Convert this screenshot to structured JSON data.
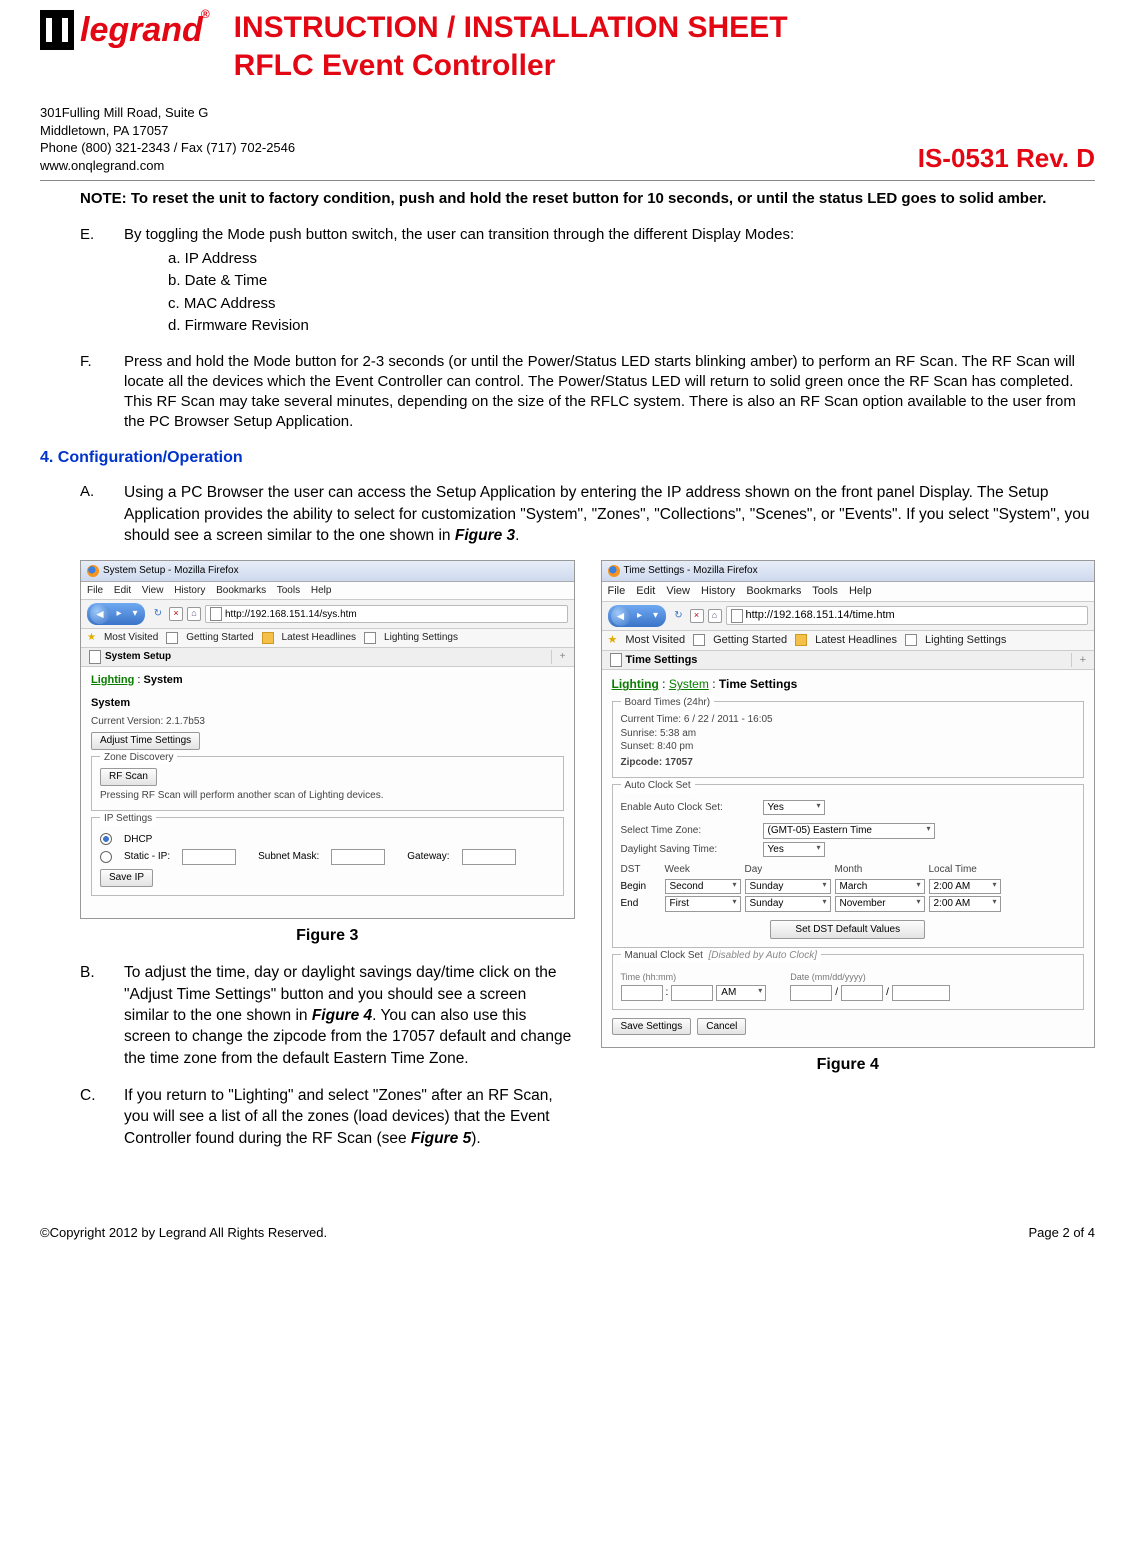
{
  "header": {
    "logo_text": "legrand",
    "logo_sup": "®",
    "title_line1": "INSTRUCTION / INSTALLATION SHEET",
    "title_line2": "RFLC Event Controller"
  },
  "meta": {
    "addr1": "301Fulling Mill Road, Suite G",
    "addr2": "Middletown, PA 17057",
    "addr3": "Phone (800) 321-2343 / Fax (717) 702-2546",
    "addr4": "www.onqlegrand.com",
    "rev": "IS-0531 Rev. D"
  },
  "body": {
    "note": "NOTE: To reset the unit to factory condition, push and hold the reset button for 10 seconds, or until the status LED goes to solid amber.",
    "E_letter": "E.",
    "E_text": "By toggling the Mode push button switch, the user can transition through the different Display Modes:",
    "E_sub": {
      "a": "a.    IP Address",
      "b": "b.    Date & Time",
      "c": "c.    MAC Address",
      "d": "d.    Firmware Revision"
    },
    "F_letter": "F.",
    "F_text": "Press and hold the Mode button for 2-3 seconds (or until the Power/Status LED starts blinking amber) to perform an RF Scan. The RF Scan will locate all the devices which the Event Controller can control. The Power/Status LED will return to solid green once the RF Scan has completed. This RF Scan may take several minutes, depending on the size of the RFLC system. There is also an RF Scan option available to the user from the PC Browser Setup Application.",
    "section4": "4.   Configuration/Operation",
    "A_letter": "A.",
    "A_text_1": "Using a PC Browser the user can access the Setup Application by entering the IP address shown on the front panel Display. The Setup Application provides the ability to select for customization \"System\", \"Zones\", \"Collections\", \"Scenes\", or \"Events\". If you select \"System\", you should see a screen similar to the one shown in ",
    "A_fig_ref": "Figure 3",
    "A_text_2": ".",
    "B_letter": "B.",
    "B_text_1": "To adjust the time, day or daylight savings day/time click on the \"Adjust Time Settings\" button and you should see a screen similar to the one shown in ",
    "B_fig_ref": "Figure 4",
    "B_text_2": ". You can also use this screen to change the zipcode from the 17057 default and change the time zone from the default Eastern Time Zone.",
    "C_letter": "C.",
    "C_text_1": "If you return to \"Lighting\" and select \"Zones\" after an RF Scan, you will see a list of all the zones (load devices) that the Event Controller found during the RF Scan (see ",
    "C_fig_ref": "Figure 5",
    "C_text_2": ")."
  },
  "fig3": {
    "title": "System Setup - Mozilla Firefox",
    "menu": {
      "file": "File",
      "edit": "Edit",
      "view": "View",
      "history": "History",
      "bookmarks": "Bookmarks",
      "tools": "Tools",
      "help": "Help"
    },
    "url": "http://192.168.151.14/sys.htm",
    "bm_mv": "Most Visited",
    "bm_gs": "Getting Started",
    "bm_lh": "Latest Headlines",
    "bm_ls": "Lighting Settings",
    "tab": "System Setup",
    "crumb_lighting": "Lighting",
    "crumb_sep": " : ",
    "crumb_system": "System",
    "section_system": "System",
    "version_label": "Current Version: 2.1.7b53",
    "adjust_btn": "Adjust Time Settings",
    "legend_zone": "Zone Discovery",
    "rf_scan_btn": "RF Scan",
    "rf_scan_text": "Pressing RF Scan will perform another scan of Lighting devices.",
    "legend_ip": "IP Settings",
    "dhcp": "DHCP",
    "static": "Static - IP:",
    "subnet_lbl": "Subnet Mask:",
    "gateway_lbl": "Gateway:",
    "save_ip": "Save IP",
    "caption": "Figure 3"
  },
  "fig4": {
    "title": "Time Settings - Mozilla Firefox",
    "menu": {
      "file": "File",
      "edit": "Edit",
      "view": "View",
      "history": "History",
      "bookmarks": "Bookmarks",
      "tools": "Tools",
      "help": "Help"
    },
    "url": "http://192.168.151.14/time.htm",
    "bm_mv": "Most Visited",
    "bm_gs": "Getting Started",
    "bm_lh": "Latest Headlines",
    "bm_ls": "Lighting Settings",
    "tab": "Time Settings",
    "crumb_lighting": "Lighting",
    "crumb_sep1": " : ",
    "crumb_system": "System",
    "crumb_sep2": " : ",
    "crumb_time": "Time Settings",
    "legend_board": "Board Times (24hr)",
    "current_time": "Current Time: 6 / 22 / 2011 - 16:05",
    "sunrise": "Sunrise: 5:38 am",
    "sunset": "Sunset: 8:40 pm",
    "zip_label": "Zipcode:  17057",
    "legend_auto": "Auto Clock Set",
    "enable_lbl": "Enable Auto Clock Set:",
    "enable_val": "Yes",
    "tz_lbl": "Select Time Zone:",
    "tz_val": "(GMT-05) Eastern Time",
    "dst_lbl": "Daylight Saving Time:",
    "dst_val": "Yes",
    "hdr_dst": "DST",
    "hdr_week": "Week",
    "hdr_day": "Day",
    "hdr_month": "Month",
    "hdr_local": "Local Time",
    "row_begin": "Begin",
    "begin_week": "Second",
    "begin_day": "Sunday",
    "begin_month": "March",
    "begin_time": "2:00 AM",
    "row_end": "End",
    "end_week": "First",
    "end_day": "Sunday",
    "end_month": "November",
    "end_time": "2:00 AM",
    "set_dst_btn": "Set DST Default Values",
    "legend_manual": "Manual Clock Set",
    "legend_manual_note": "[Disabled by Auto Clock]",
    "time_lbl": "Time (hh:mm)",
    "date_lbl": "Date (mm/dd/yyyy)",
    "ampm": "AM",
    "slash": "/",
    "colon": ":",
    "save_btn": "Save Settings",
    "cancel_btn": "Cancel",
    "caption": "Figure 4"
  },
  "footer": {
    "copyright": "©Copyright 2012 by Legrand All Rights Reserved.",
    "page": "Page 2 of 4"
  }
}
